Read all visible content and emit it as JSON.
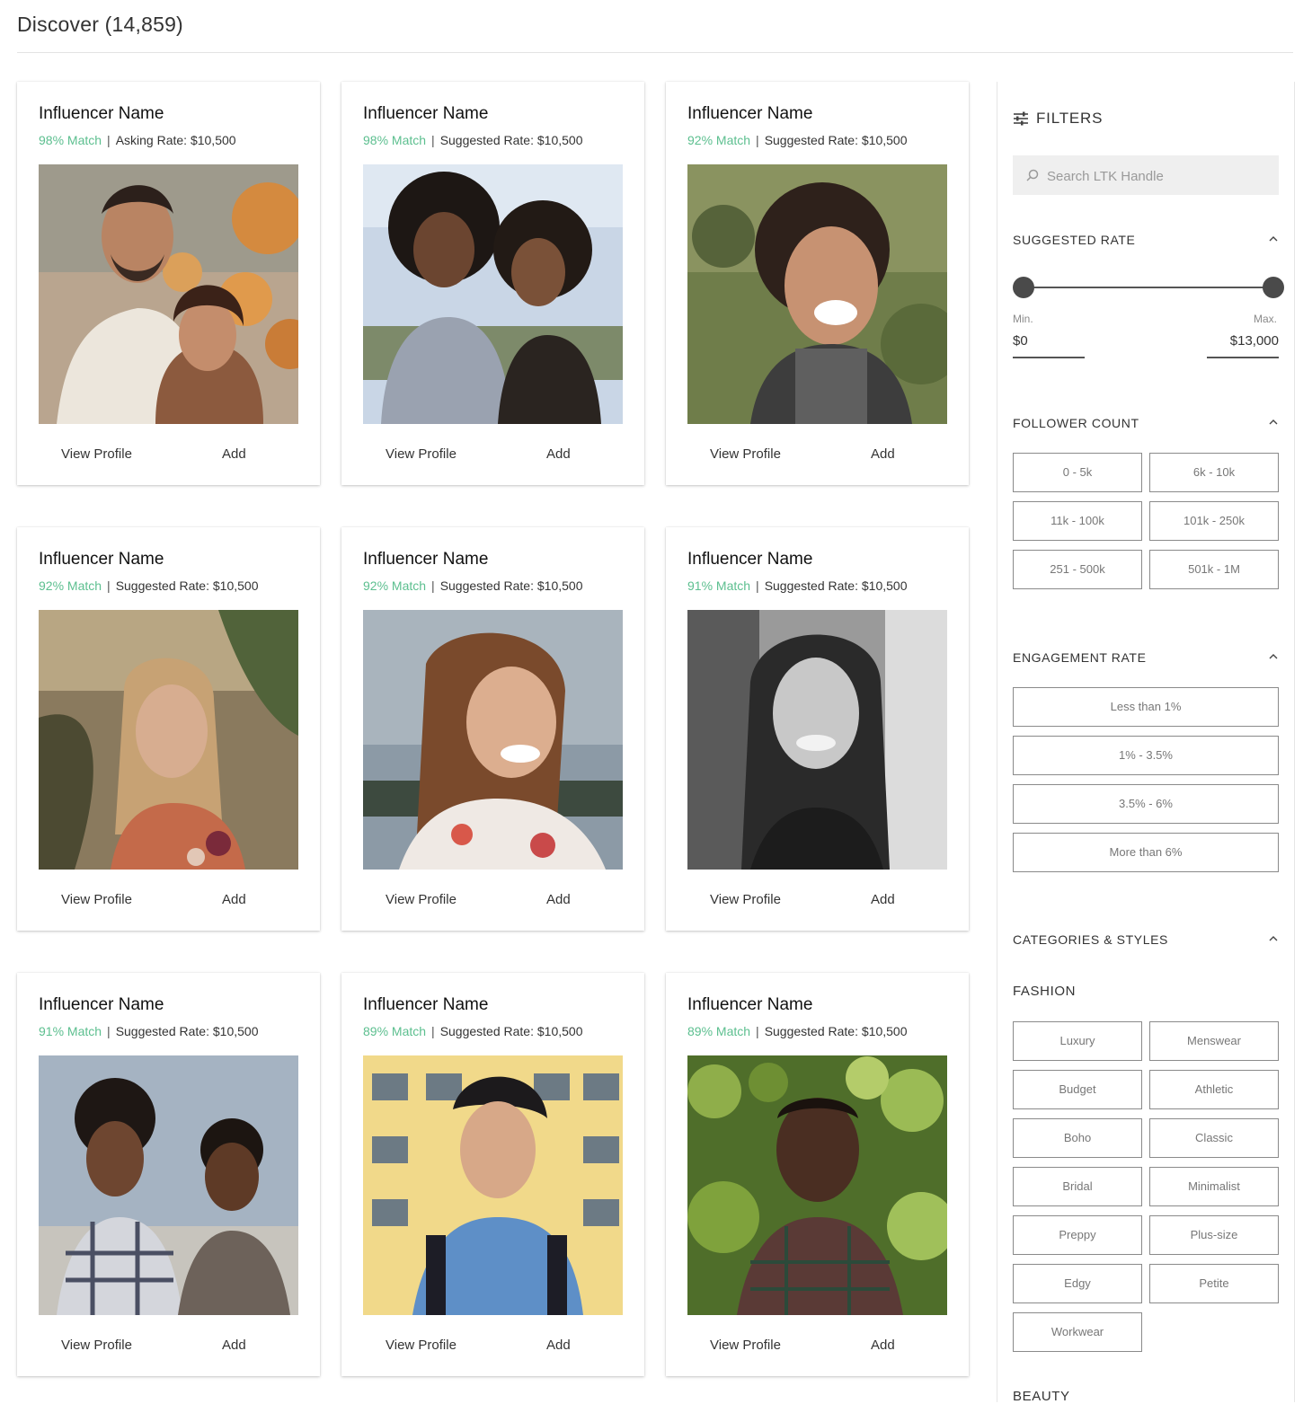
{
  "header": {
    "title": "Discover (14,859)"
  },
  "cards": [
    {
      "name": "Influencer Name",
      "match": "98% Match",
      "rate": "Asking Rate: $10,500",
      "view_label": "View Profile",
      "add_label": "Add"
    },
    {
      "name": "Influencer Name",
      "match": "98% Match",
      "rate": "Suggested Rate: $10,500",
      "view_label": "View Profile",
      "add_label": "Add"
    },
    {
      "name": "Influencer Name",
      "match": "92% Match",
      "rate": "Suggested Rate: $10,500",
      "view_label": "View Profile",
      "add_label": "Add"
    },
    {
      "name": "Influencer Name",
      "match": "92% Match",
      "rate": "Suggested Rate: $10,500",
      "view_label": "View Profile",
      "add_label": "Add"
    },
    {
      "name": "Influencer Name",
      "match": "92% Match",
      "rate": "Suggested Rate: $10,500",
      "view_label": "View Profile",
      "add_label": "Add"
    },
    {
      "name": "Influencer Name",
      "match": "91% Match",
      "rate": "Suggested Rate: $10,500",
      "view_label": "View Profile",
      "add_label": "Add"
    },
    {
      "name": "Influencer Name",
      "match": "91% Match",
      "rate": "Suggested Rate: $10,500",
      "view_label": "View Profile",
      "add_label": "Add"
    },
    {
      "name": "Influencer Name",
      "match": "89% Match",
      "rate": "Suggested Rate: $10,500",
      "view_label": "View Profile",
      "add_label": "Add"
    },
    {
      "name": "Influencer Name",
      "match": "89% Match",
      "rate": "Suggested Rate: $10,500",
      "view_label": "View Profile",
      "add_label": "Add"
    }
  ],
  "filters": {
    "title": "FILTERS",
    "search_placeholder": "Search LTK Handle",
    "suggested_rate": {
      "title": "SUGGESTED RATE",
      "min_label": "Min.",
      "max_label": "Max.",
      "min_value": "$0",
      "max_value": "$13,000"
    },
    "follower_count": {
      "title": "FOLLOWER COUNT",
      "options": [
        "0 - 5k",
        "6k - 10k",
        "11k - 100k",
        "101k - 250k",
        "251 - 500k",
        "501k - 1M"
      ]
    },
    "engagement_rate": {
      "title": "ENGAGEMENT RATE",
      "options": [
        "Less than 1%",
        "1% - 3.5%",
        "3.5% - 6%",
        "More than 6%"
      ]
    },
    "categories": {
      "title": "CATEGORIES & STYLES",
      "fashion_title": "FASHION",
      "fashion_options": [
        "Luxury",
        "Menswear",
        "Budget",
        "Athletic",
        "Boho",
        "Classic",
        "Bridal",
        "Minimalist",
        "Preppy",
        "Plus-size",
        "Edgy",
        "Petite",
        "Workwear"
      ],
      "next_title": "BEAUTY"
    }
  },
  "colors": {
    "match_green": "#5cbf8f",
    "knob": "#4a4a4a"
  },
  "icons": {
    "filters": "sliders-icon",
    "search": "search-icon",
    "collapse": "chevron-up-icon"
  }
}
